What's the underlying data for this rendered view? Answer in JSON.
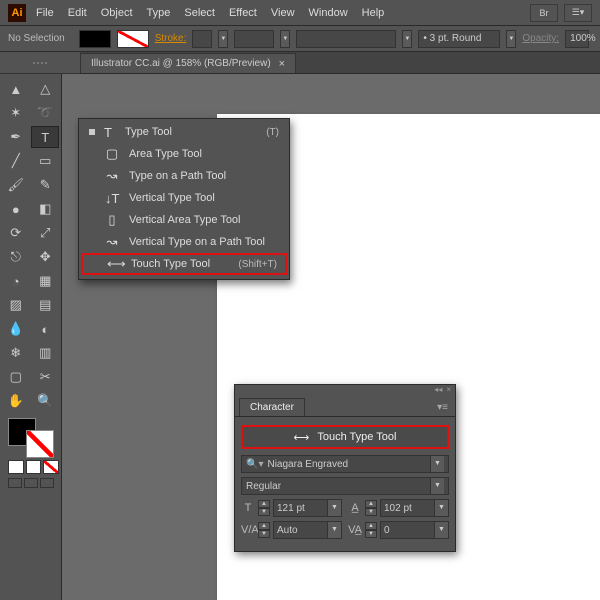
{
  "menubar": {
    "logo": "Ai",
    "items": [
      "File",
      "Edit",
      "Object",
      "Type",
      "Select",
      "Effect",
      "View",
      "Window",
      "Help"
    ],
    "topRight": [
      "Br",
      "☰▾"
    ]
  },
  "ctrl": {
    "selection": "No Selection",
    "stroke_label": "Stroke:",
    "brush": "3 pt. Round",
    "opacity_label": "Opacity:",
    "opacity_value": "100%"
  },
  "doc": {
    "tab_label": "Illustrator CC.ai @ 158% (RGB/Preview)",
    "close": "×"
  },
  "tools": [
    [
      "select-tool",
      "direct-select-tool"
    ],
    [
      "magic-wand-tool",
      "lasso-tool"
    ],
    [
      "pen-tool",
      "type-tool"
    ],
    [
      "line-tool",
      "rectangle-tool"
    ],
    [
      "paintbrush-tool",
      "pencil-tool"
    ],
    [
      "blob-brush-tool",
      "eraser-tool"
    ],
    [
      "rotate-tool",
      "scale-tool"
    ],
    [
      "width-tool",
      "free-transform-tool"
    ],
    [
      "shape-builder-tool",
      "perspective-tool"
    ],
    [
      "mesh-tool",
      "gradient-tool"
    ],
    [
      "eyedropper-tool",
      "blend-tool"
    ],
    [
      "symbol-sprayer-tool",
      "column-graph-tool"
    ],
    [
      "artboard-tool",
      "slice-tool"
    ],
    [
      "hand-tool",
      "zoom-tool"
    ]
  ],
  "toolGlyphs": {
    "select-tool": "▲",
    "direct-select-tool": "△",
    "magic-wand-tool": "✶",
    "lasso-tool": "➰",
    "pen-tool": "✒",
    "type-tool": "T",
    "line-tool": "╱",
    "rectangle-tool": "▭",
    "paintbrush-tool": "🖌",
    "pencil-tool": "✎",
    "blob-brush-tool": "●",
    "eraser-tool": "◧",
    "rotate-tool": "⟳",
    "scale-tool": "⤢",
    "width-tool": "⎋",
    "free-transform-tool": "✥",
    "shape-builder-tool": "◔",
    "perspective-tool": "▦",
    "mesh-tool": "▨",
    "gradient-tool": "▤",
    "eyedropper-tool": "💧",
    "blend-tool": "◐",
    "symbol-sprayer-tool": "❄",
    "column-graph-tool": "▥",
    "artboard-tool": "▢",
    "slice-tool": "✂",
    "hand-tool": "✋",
    "zoom-tool": "🔍"
  },
  "flyout": {
    "items": [
      {
        "icon": "T",
        "label": "Type Tool",
        "shortcut": "(T)",
        "current": true
      },
      {
        "icon": "▢",
        "label": "Area Type Tool",
        "shortcut": ""
      },
      {
        "icon": "↝",
        "label": "Type on a Path Tool",
        "shortcut": ""
      },
      {
        "icon": "↓T",
        "label": "Vertical Type Tool",
        "shortcut": ""
      },
      {
        "icon": "▯",
        "label": "Vertical Area Type Tool",
        "shortcut": ""
      },
      {
        "icon": "↝",
        "label": "Vertical Type on a Path Tool",
        "shortcut": ""
      },
      {
        "icon": "⟷",
        "label": "Touch Type Tool",
        "shortcut": "(Shift+T)",
        "highlight": true
      }
    ]
  },
  "charPanel": {
    "title": "Character",
    "touch_label": "Touch Type Tool",
    "font": "Niagara Engraved",
    "style": "Regular",
    "size_label": "T",
    "size": "121 pt",
    "leading_label": "A",
    "leading": "102 pt",
    "kerning_label": "VA",
    "kerning": "Auto",
    "tracking_label": "VA",
    "tracking": "0"
  }
}
